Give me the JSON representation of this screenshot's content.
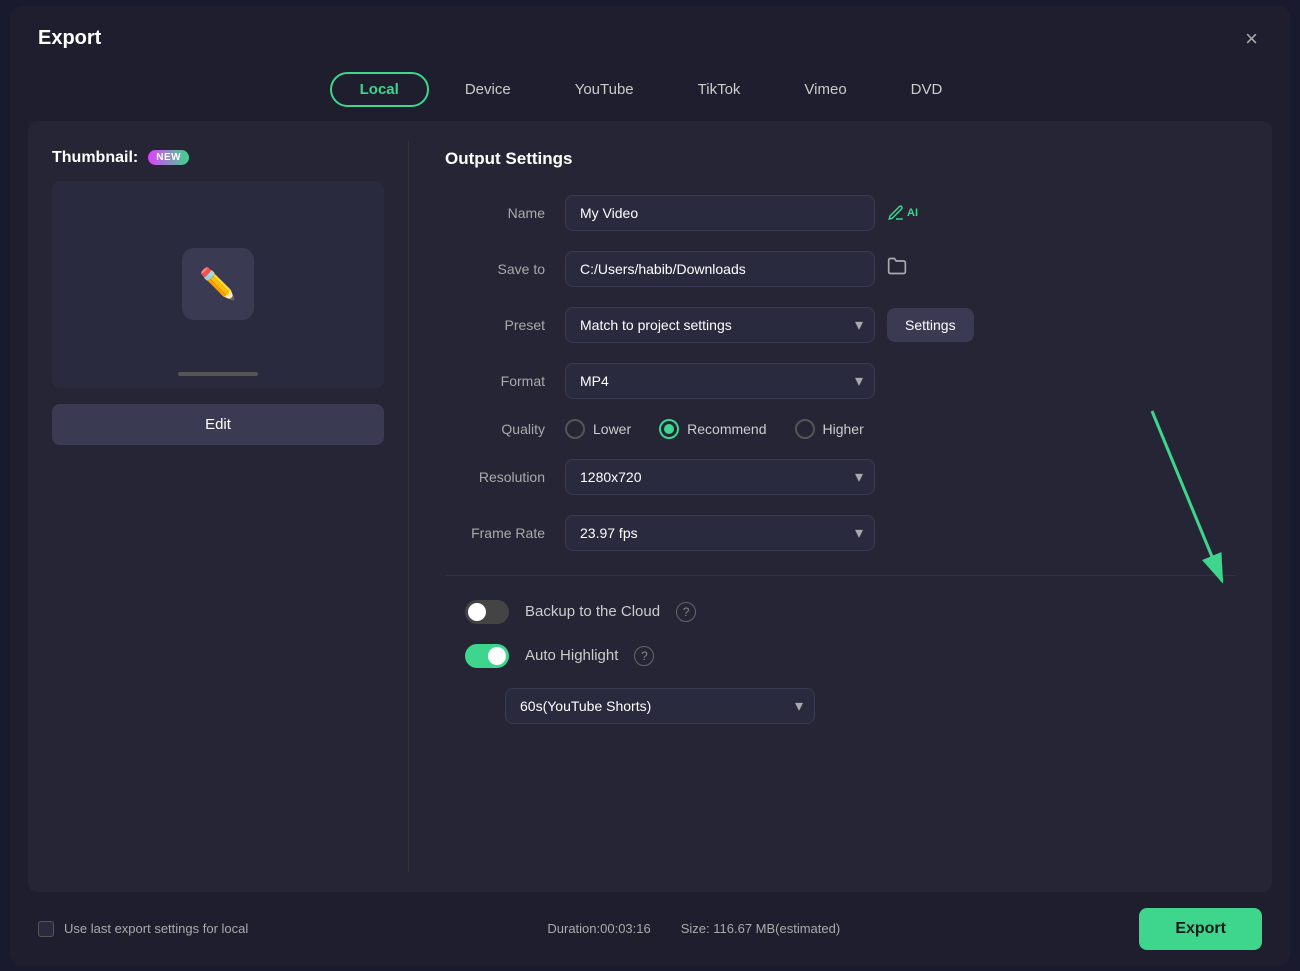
{
  "dialog": {
    "title": "Export",
    "close_label": "×"
  },
  "tabs": [
    {
      "id": "local",
      "label": "Local",
      "active": true
    },
    {
      "id": "device",
      "label": "Device",
      "active": false
    },
    {
      "id": "youtube",
      "label": "YouTube",
      "active": false
    },
    {
      "id": "tiktok",
      "label": "TikTok",
      "active": false
    },
    {
      "id": "vimeo",
      "label": "Vimeo",
      "active": false
    },
    {
      "id": "dvd",
      "label": "DVD",
      "active": false
    }
  ],
  "left_panel": {
    "thumbnail_label": "Thumbnail:",
    "new_badge": "NEW",
    "edit_button": "Edit"
  },
  "right_panel": {
    "section_title": "Output Settings",
    "name_label": "Name",
    "name_value": "My Video",
    "save_to_label": "Save to",
    "save_to_value": "C:/Users/habib/Downloads",
    "preset_label": "Preset",
    "preset_value": "Match to project settings",
    "settings_button": "Settings",
    "format_label": "Format",
    "format_value": "MP4",
    "quality_label": "Quality",
    "quality_options": [
      {
        "id": "lower",
        "label": "Lower",
        "checked": false
      },
      {
        "id": "recommend",
        "label": "Recommend",
        "checked": true
      },
      {
        "id": "higher",
        "label": "Higher",
        "checked": false
      }
    ],
    "resolution_label": "Resolution",
    "resolution_value": "1280x720",
    "frame_rate_label": "Frame Rate",
    "frame_rate_value": "23.97 fps",
    "backup_label": "Backup to the Cloud",
    "backup_on": false,
    "auto_highlight_label": "Auto Highlight",
    "auto_highlight_on": true,
    "shorts_value": "60s(YouTube Shorts)"
  },
  "footer": {
    "checkbox_label": "Use last export settings for local",
    "duration_label": "Duration:00:03:16",
    "size_label": "Size: 116.67 MB(estimated)",
    "export_button": "Export"
  }
}
